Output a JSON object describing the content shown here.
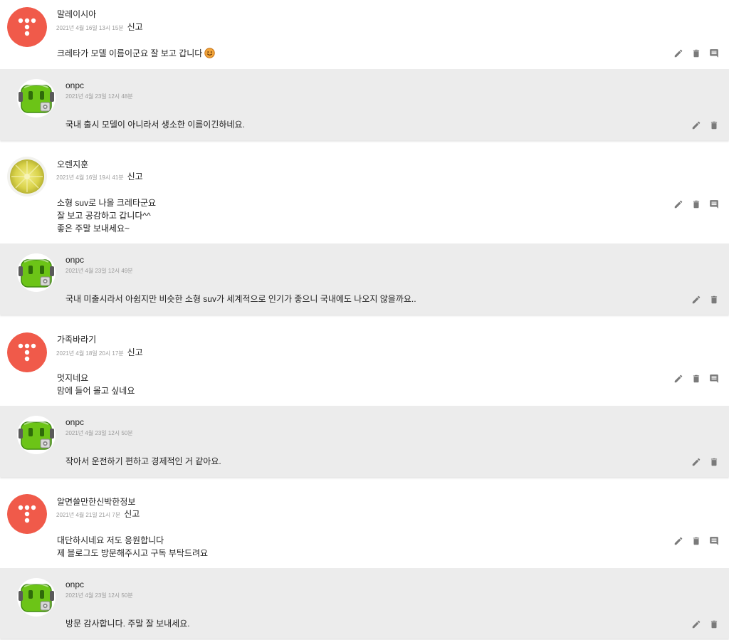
{
  "report_label": "신고",
  "threads": [
    {
      "comment": {
        "author": "말레이시아",
        "date": "2021년 4월 16일 13시 15분",
        "avatar": "t-logo-avatar",
        "lines": [
          "크레타가 모델 이름이군요 잘 보고 갑니다"
        ],
        "has_emoji": true
      },
      "reply": {
        "author": "onpc",
        "date": "2021년 4월 23일 12시 48분",
        "avatar": "green-robot-avatar",
        "lines": [
          "국내 출시 모델이 아니라서 생소한 이름이긴하네요."
        ]
      }
    },
    {
      "comment": {
        "author": "오렌지훈",
        "date": "2021년 4월 16일 19시 41분",
        "avatar": "lemon-slice-avatar",
        "lines": [
          "소형 suv로 나올 크레타군요",
          "잘 보고 공감하고 갑니다^^",
          "좋은 주말 보내세요~"
        ]
      },
      "reply": {
        "author": "onpc",
        "date": "2021년 4월 23일 12시 49분",
        "avatar": "green-robot-avatar",
        "lines": [
          "국내 미출시라서 아쉽지만 비슷한 소형 suv가 세계적으로 인기가 좋으니 국내에도 나오지 않을까요.."
        ]
      }
    },
    {
      "comment": {
        "author": "가족바라기",
        "date": "2021년 4월 18일 20시 17분",
        "avatar": "t-logo-avatar",
        "lines": [
          "멋지네요",
          "맘에 들어 몰고 싶네요"
        ]
      },
      "reply": {
        "author": "onpc",
        "date": "2021년 4월 23일 12시 50분",
        "avatar": "green-robot-avatar",
        "lines": [
          "작아서 운전하기 편하고 경제적인 거 같아요."
        ]
      }
    },
    {
      "comment": {
        "author": "알면쓸만한신박한정보",
        "date": "2021년 4월 21일 21시 7분",
        "avatar": "t-logo-avatar",
        "lines": [
          "대단하시네요 저도 응원합니다",
          "제 블로그도 방문해주시고 구독 부탁드려요"
        ]
      },
      "reply": {
        "author": "onpc",
        "date": "2021년 4월 23일 12시 50분",
        "avatar": "green-robot-avatar",
        "lines": [
          "방문 감사합니다. 주말 잘 보내세요."
        ]
      }
    }
  ],
  "colors": {
    "reply_background": "#ececec",
    "t_logo_red": "#f05a4a",
    "robot_green": "#6cc417",
    "icon_gray": "#7a7a7a"
  },
  "icons": {
    "edit": "pencil-icon",
    "delete": "trash-icon",
    "reply": "comment-icon",
    "emoji": "smiley-emoji-icon"
  }
}
